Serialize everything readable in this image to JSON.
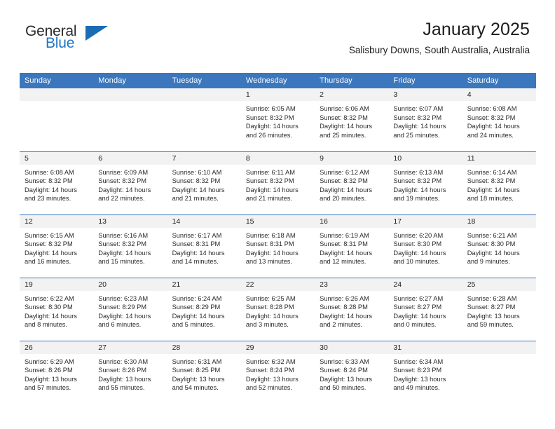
{
  "brand": {
    "name_part1": "General",
    "name_part2": "Blue",
    "accent_color": "#2176c7",
    "triangle_color": "#1a6cb5"
  },
  "header": {
    "title": "January 2025",
    "subtitle": "Salisbury Downs, South Australia, Australia",
    "header_bg_color": "#3b77bd",
    "daynum_bg_color": "#f2f2f2"
  },
  "weekdays": [
    "Sunday",
    "Monday",
    "Tuesday",
    "Wednesday",
    "Thursday",
    "Friday",
    "Saturday"
  ],
  "weeks": [
    [
      {
        "day": "",
        "sunrise": "",
        "sunset": "",
        "daylight_line1": "",
        "daylight_line2": ""
      },
      {
        "day": "",
        "sunrise": "",
        "sunset": "",
        "daylight_line1": "",
        "daylight_line2": ""
      },
      {
        "day": "",
        "sunrise": "",
        "sunset": "",
        "daylight_line1": "",
        "daylight_line2": ""
      },
      {
        "day": "1",
        "sunrise": "Sunrise: 6:05 AM",
        "sunset": "Sunset: 8:32 PM",
        "daylight_line1": "Daylight: 14 hours",
        "daylight_line2": "and 26 minutes."
      },
      {
        "day": "2",
        "sunrise": "Sunrise: 6:06 AM",
        "sunset": "Sunset: 8:32 PM",
        "daylight_line1": "Daylight: 14 hours",
        "daylight_line2": "and 25 minutes."
      },
      {
        "day": "3",
        "sunrise": "Sunrise: 6:07 AM",
        "sunset": "Sunset: 8:32 PM",
        "daylight_line1": "Daylight: 14 hours",
        "daylight_line2": "and 25 minutes."
      },
      {
        "day": "4",
        "sunrise": "Sunrise: 6:08 AM",
        "sunset": "Sunset: 8:32 PM",
        "daylight_line1": "Daylight: 14 hours",
        "daylight_line2": "and 24 minutes."
      }
    ],
    [
      {
        "day": "5",
        "sunrise": "Sunrise: 6:08 AM",
        "sunset": "Sunset: 8:32 PM",
        "daylight_line1": "Daylight: 14 hours",
        "daylight_line2": "and 23 minutes."
      },
      {
        "day": "6",
        "sunrise": "Sunrise: 6:09 AM",
        "sunset": "Sunset: 8:32 PM",
        "daylight_line1": "Daylight: 14 hours",
        "daylight_line2": "and 22 minutes."
      },
      {
        "day": "7",
        "sunrise": "Sunrise: 6:10 AM",
        "sunset": "Sunset: 8:32 PM",
        "daylight_line1": "Daylight: 14 hours",
        "daylight_line2": "and 21 minutes."
      },
      {
        "day": "8",
        "sunrise": "Sunrise: 6:11 AM",
        "sunset": "Sunset: 8:32 PM",
        "daylight_line1": "Daylight: 14 hours",
        "daylight_line2": "and 21 minutes."
      },
      {
        "day": "9",
        "sunrise": "Sunrise: 6:12 AM",
        "sunset": "Sunset: 8:32 PM",
        "daylight_line1": "Daylight: 14 hours",
        "daylight_line2": "and 20 minutes."
      },
      {
        "day": "10",
        "sunrise": "Sunrise: 6:13 AM",
        "sunset": "Sunset: 8:32 PM",
        "daylight_line1": "Daylight: 14 hours",
        "daylight_line2": "and 19 minutes."
      },
      {
        "day": "11",
        "sunrise": "Sunrise: 6:14 AM",
        "sunset": "Sunset: 8:32 PM",
        "daylight_line1": "Daylight: 14 hours",
        "daylight_line2": "and 18 minutes."
      }
    ],
    [
      {
        "day": "12",
        "sunrise": "Sunrise: 6:15 AM",
        "sunset": "Sunset: 8:32 PM",
        "daylight_line1": "Daylight: 14 hours",
        "daylight_line2": "and 16 minutes."
      },
      {
        "day": "13",
        "sunrise": "Sunrise: 6:16 AM",
        "sunset": "Sunset: 8:32 PM",
        "daylight_line1": "Daylight: 14 hours",
        "daylight_line2": "and 15 minutes."
      },
      {
        "day": "14",
        "sunrise": "Sunrise: 6:17 AM",
        "sunset": "Sunset: 8:31 PM",
        "daylight_line1": "Daylight: 14 hours",
        "daylight_line2": "and 14 minutes."
      },
      {
        "day": "15",
        "sunrise": "Sunrise: 6:18 AM",
        "sunset": "Sunset: 8:31 PM",
        "daylight_line1": "Daylight: 14 hours",
        "daylight_line2": "and 13 minutes."
      },
      {
        "day": "16",
        "sunrise": "Sunrise: 6:19 AM",
        "sunset": "Sunset: 8:31 PM",
        "daylight_line1": "Daylight: 14 hours",
        "daylight_line2": "and 12 minutes."
      },
      {
        "day": "17",
        "sunrise": "Sunrise: 6:20 AM",
        "sunset": "Sunset: 8:30 PM",
        "daylight_line1": "Daylight: 14 hours",
        "daylight_line2": "and 10 minutes."
      },
      {
        "day": "18",
        "sunrise": "Sunrise: 6:21 AM",
        "sunset": "Sunset: 8:30 PM",
        "daylight_line1": "Daylight: 14 hours",
        "daylight_line2": "and 9 minutes."
      }
    ],
    [
      {
        "day": "19",
        "sunrise": "Sunrise: 6:22 AM",
        "sunset": "Sunset: 8:30 PM",
        "daylight_line1": "Daylight: 14 hours",
        "daylight_line2": "and 8 minutes."
      },
      {
        "day": "20",
        "sunrise": "Sunrise: 6:23 AM",
        "sunset": "Sunset: 8:29 PM",
        "daylight_line1": "Daylight: 14 hours",
        "daylight_line2": "and 6 minutes."
      },
      {
        "day": "21",
        "sunrise": "Sunrise: 6:24 AM",
        "sunset": "Sunset: 8:29 PM",
        "daylight_line1": "Daylight: 14 hours",
        "daylight_line2": "and 5 minutes."
      },
      {
        "day": "22",
        "sunrise": "Sunrise: 6:25 AM",
        "sunset": "Sunset: 8:28 PM",
        "daylight_line1": "Daylight: 14 hours",
        "daylight_line2": "and 3 minutes."
      },
      {
        "day": "23",
        "sunrise": "Sunrise: 6:26 AM",
        "sunset": "Sunset: 8:28 PM",
        "daylight_line1": "Daylight: 14 hours",
        "daylight_line2": "and 2 minutes."
      },
      {
        "day": "24",
        "sunrise": "Sunrise: 6:27 AM",
        "sunset": "Sunset: 8:27 PM",
        "daylight_line1": "Daylight: 14 hours",
        "daylight_line2": "and 0 minutes."
      },
      {
        "day": "25",
        "sunrise": "Sunrise: 6:28 AM",
        "sunset": "Sunset: 8:27 PM",
        "daylight_line1": "Daylight: 13 hours",
        "daylight_line2": "and 59 minutes."
      }
    ],
    [
      {
        "day": "26",
        "sunrise": "Sunrise: 6:29 AM",
        "sunset": "Sunset: 8:26 PM",
        "daylight_line1": "Daylight: 13 hours",
        "daylight_line2": "and 57 minutes."
      },
      {
        "day": "27",
        "sunrise": "Sunrise: 6:30 AM",
        "sunset": "Sunset: 8:26 PM",
        "daylight_line1": "Daylight: 13 hours",
        "daylight_line2": "and 55 minutes."
      },
      {
        "day": "28",
        "sunrise": "Sunrise: 6:31 AM",
        "sunset": "Sunset: 8:25 PM",
        "daylight_line1": "Daylight: 13 hours",
        "daylight_line2": "and 54 minutes."
      },
      {
        "day": "29",
        "sunrise": "Sunrise: 6:32 AM",
        "sunset": "Sunset: 8:24 PM",
        "daylight_line1": "Daylight: 13 hours",
        "daylight_line2": "and 52 minutes."
      },
      {
        "day": "30",
        "sunrise": "Sunrise: 6:33 AM",
        "sunset": "Sunset: 8:24 PM",
        "daylight_line1": "Daylight: 13 hours",
        "daylight_line2": "and 50 minutes."
      },
      {
        "day": "31",
        "sunrise": "Sunrise: 6:34 AM",
        "sunset": "Sunset: 8:23 PM",
        "daylight_line1": "Daylight: 13 hours",
        "daylight_line2": "and 49 minutes."
      },
      {
        "day": "",
        "sunrise": "",
        "sunset": "",
        "daylight_line1": "",
        "daylight_line2": ""
      }
    ]
  ]
}
